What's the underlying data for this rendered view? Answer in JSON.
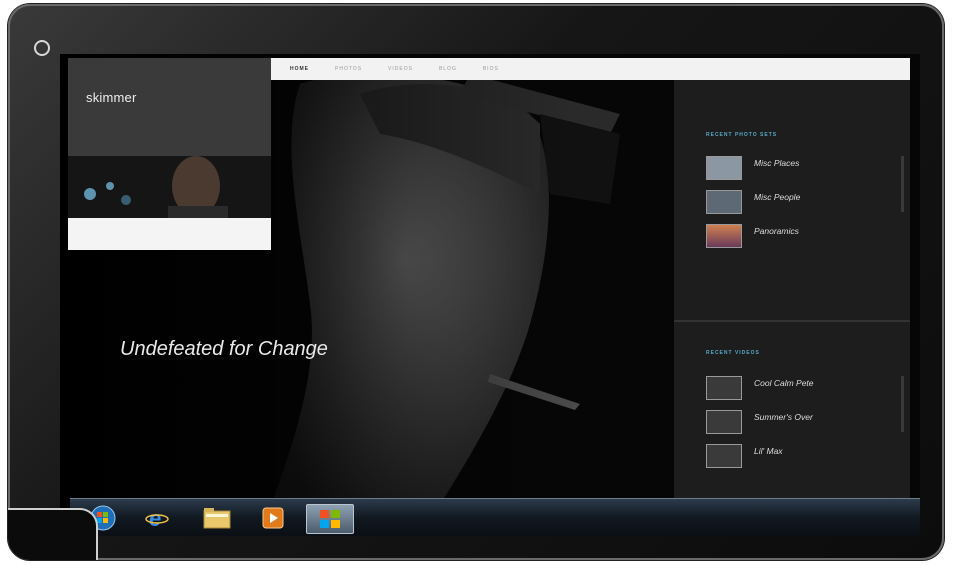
{
  "nav": {
    "items": [
      {
        "label": "HOME",
        "active": true
      },
      {
        "label": "PHOTOS",
        "active": false
      },
      {
        "label": "VIDEOS",
        "active": false
      },
      {
        "label": "BLOG",
        "active": false
      },
      {
        "label": "BIOS",
        "active": false
      }
    ]
  },
  "profile": {
    "brand": "skimmer",
    "tagline": "",
    "caption": ""
  },
  "featured": {
    "kicker": "",
    "title": "Undefeated for Change",
    "date": "",
    "body": "",
    "more": ""
  },
  "sidebar": {
    "photo_sets_title": "RECENT PHOTO SETS",
    "photo_sets": [
      {
        "name": "Misc Places",
        "sub": "",
        "thumb": "city"
      },
      {
        "name": "Misc People",
        "sub": "",
        "thumb": "person"
      },
      {
        "name": "Panoramics",
        "sub": "",
        "thumb": "sunset"
      }
    ],
    "photo_sets_footer": "",
    "videos_title": "RECENT VIDEOS",
    "videos": [
      {
        "name": "Cool Calm Pete",
        "sub": ""
      },
      {
        "name": "Summer's Over",
        "sub": ""
      },
      {
        "name": "Lil' Max",
        "sub": ""
      }
    ],
    "videos_footer": ""
  },
  "taskbar": {
    "items": [
      {
        "name": "start-orb-icon",
        "active": false
      },
      {
        "name": "internet-explorer-icon",
        "active": false
      },
      {
        "name": "folder-icon",
        "active": false
      },
      {
        "name": "media-player-icon",
        "active": false
      },
      {
        "name": "windows-icon",
        "active": true
      }
    ]
  },
  "colors": {
    "accent": "#56a9c9",
    "sidebar_bg": "#1d1d1d",
    "nav_bg": "#f2f2f2"
  }
}
